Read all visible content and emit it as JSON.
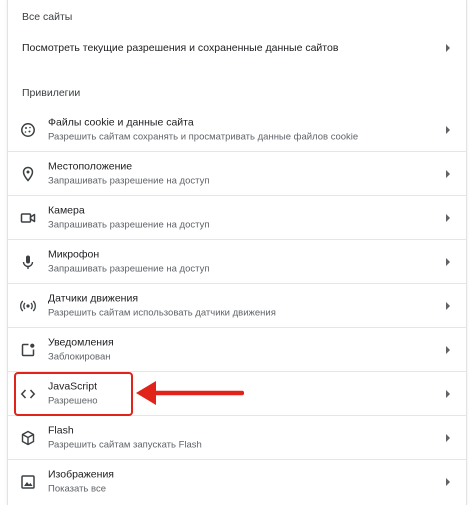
{
  "sections": {
    "all_sites_title": "Все сайты",
    "privileges_title": "Привилегии"
  },
  "view_permissions": {
    "label": "Посмотреть текущие разрешения и сохраненные данные сайтов"
  },
  "items": [
    {
      "title": "Файлы cookie и данные сайта",
      "subtitle": "Разрешить сайтам сохранять и просматривать данные файлов cookie",
      "icon": "cookie-icon"
    },
    {
      "title": "Местоположение",
      "subtitle": "Запрашивать разрешение на доступ",
      "icon": "location-pin-icon"
    },
    {
      "title": "Камера",
      "subtitle": "Запрашивать разрешение на доступ",
      "icon": "camera-icon"
    },
    {
      "title": "Микрофон",
      "subtitle": "Запрашивать разрешение на доступ",
      "icon": "microphone-icon"
    },
    {
      "title": "Датчики движения",
      "subtitle": "Разрешить сайтам использовать датчики движения",
      "icon": "motion-sensors-icon"
    },
    {
      "title": "Уведомления",
      "subtitle": "Заблокирован",
      "icon": "notification-icon"
    },
    {
      "title": "JavaScript",
      "subtitle": "Разрешено",
      "icon": "code-icon"
    },
    {
      "title": "Flash",
      "subtitle": "Разрешить сайтам запускать Flash",
      "icon": "puzzle-cube-icon"
    },
    {
      "title": "Изображения",
      "subtitle": "Показать все",
      "icon": "image-icon"
    }
  ],
  "annotation": {
    "color": "#e2231a",
    "target": "JavaScript"
  },
  "colors": {
    "text": "#202124",
    "secondary": "#5f6368",
    "divider": "#e6e6e6"
  }
}
